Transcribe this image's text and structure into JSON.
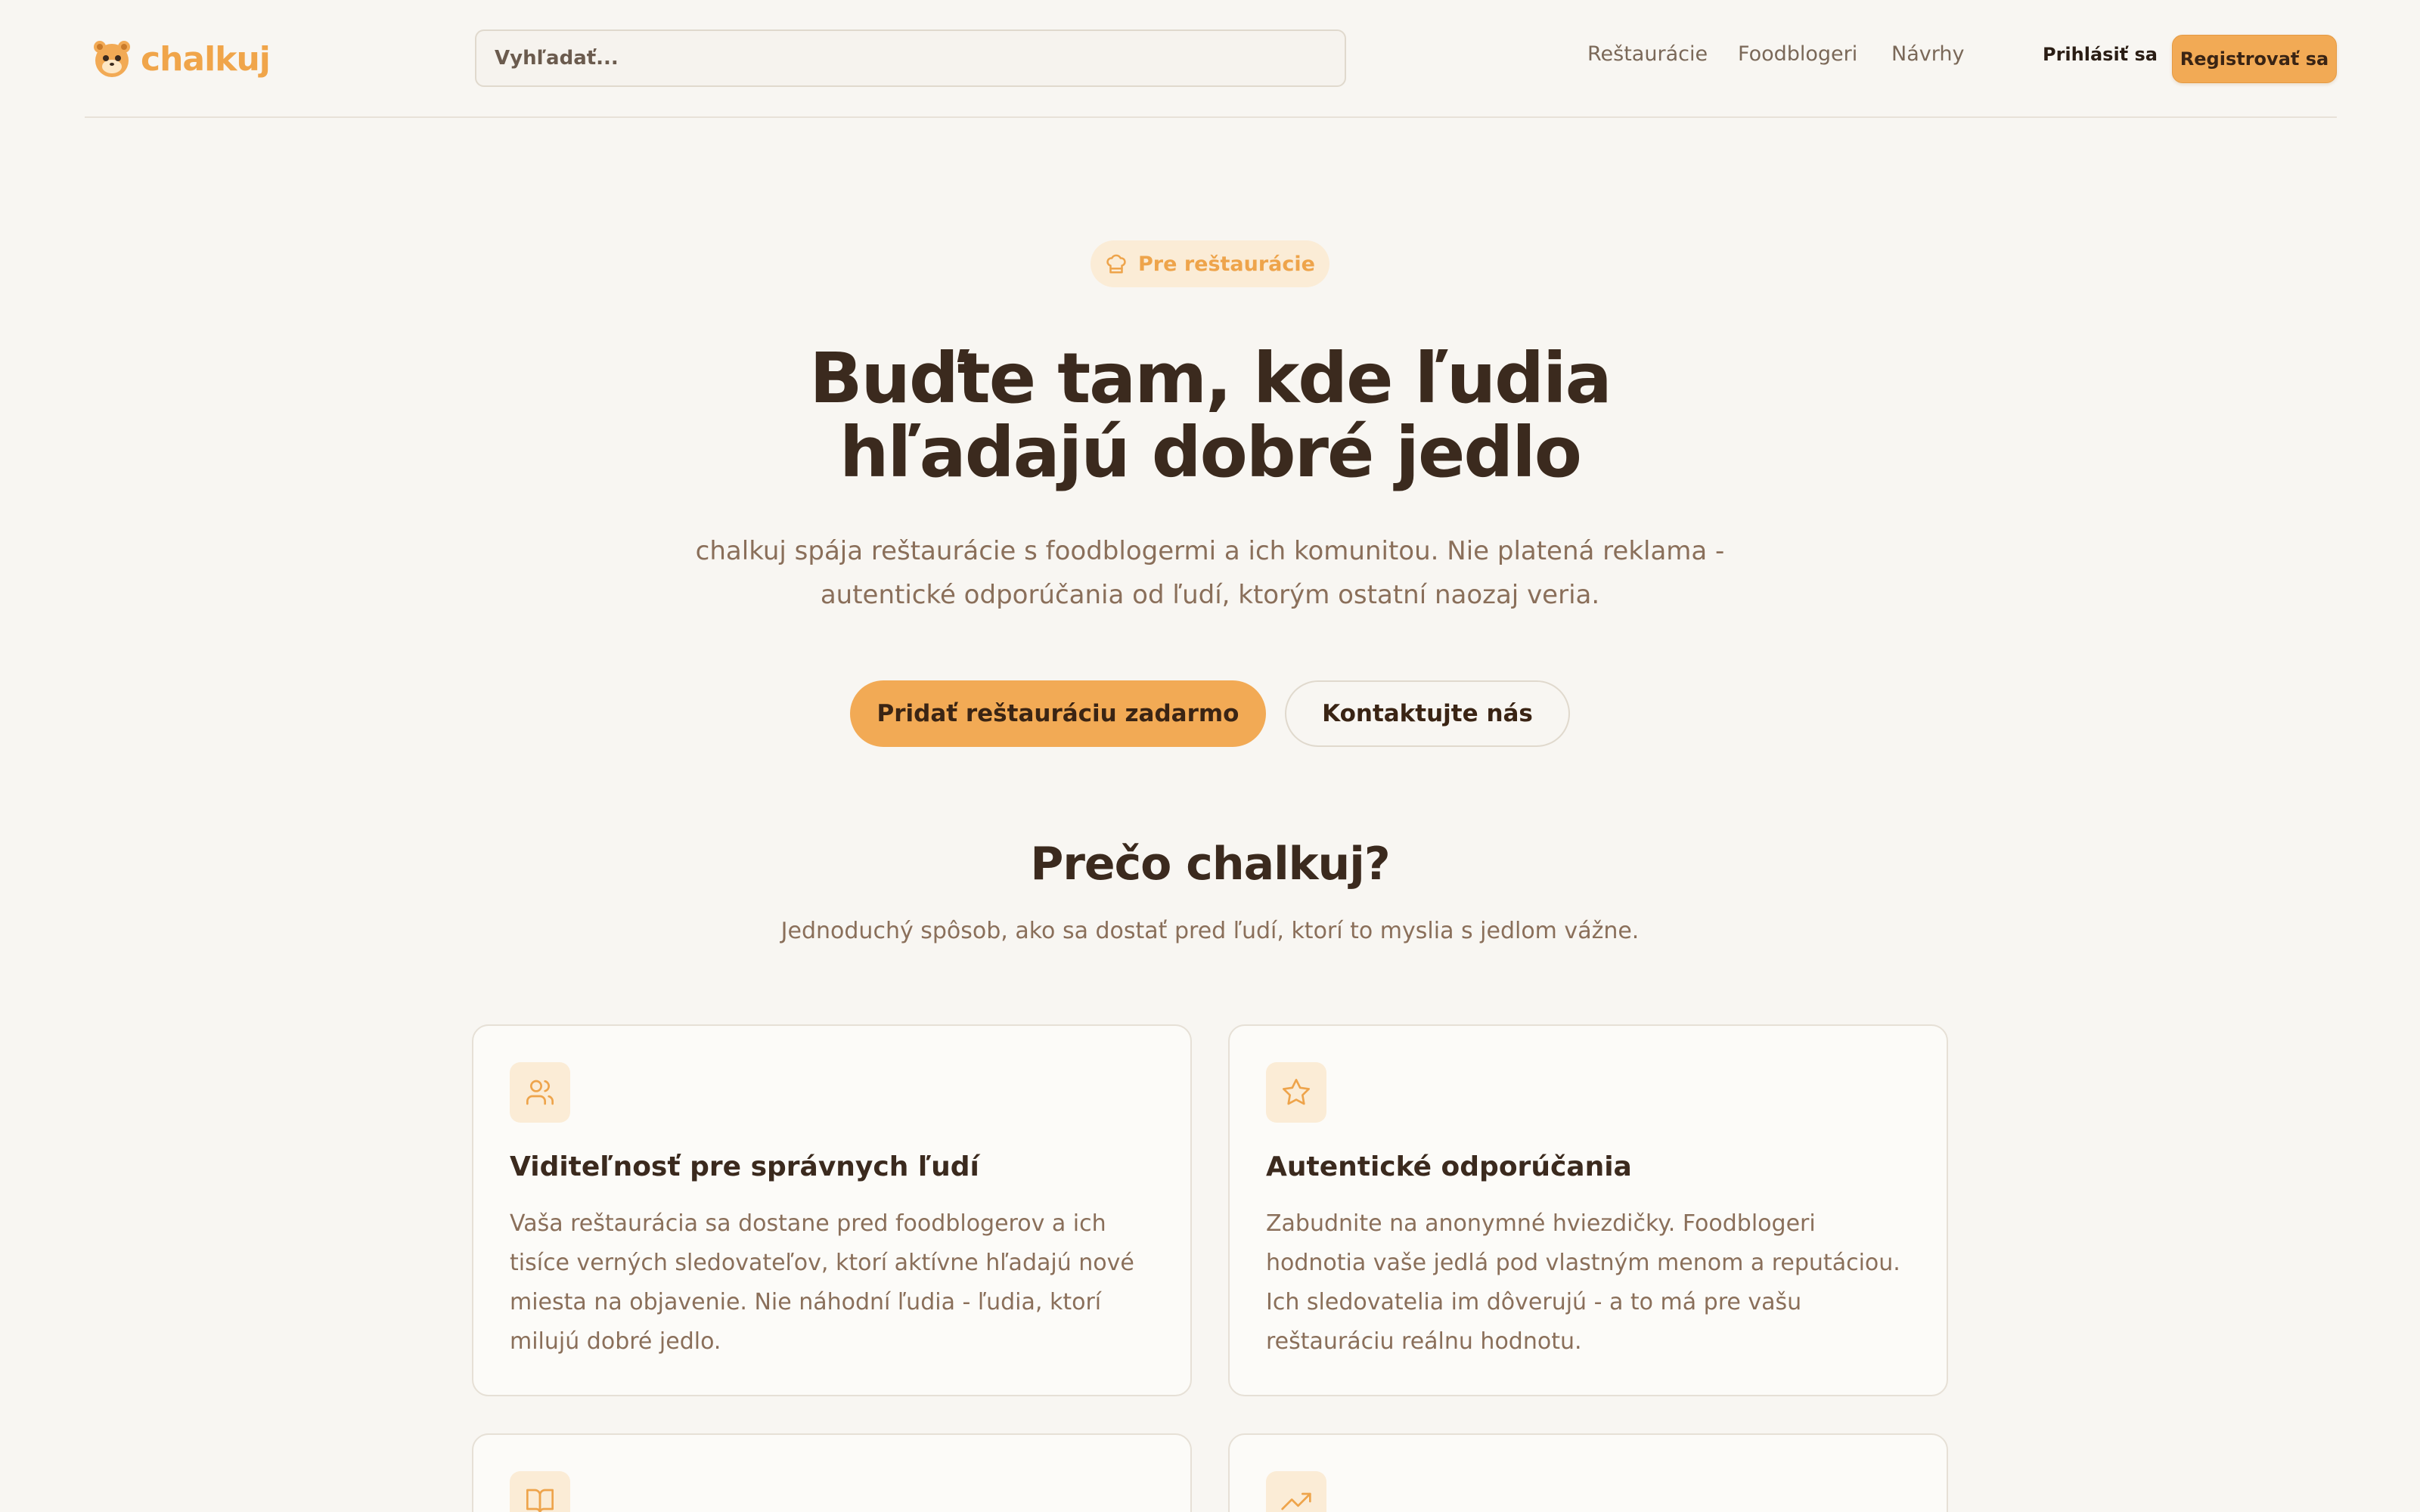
{
  "header": {
    "logo_text": "chalkuj",
    "search_placeholder": "Vyhľadať...",
    "nav": [
      "Reštaurácie",
      "Foodblogeri",
      "Návrhy"
    ],
    "login_label": "Prihlásiť sa",
    "register_label": "Registrovať sa"
  },
  "hero": {
    "badge": "Pre reštaurácie",
    "title_line1": "Buďte tam, kde ľudia",
    "title_line2": "hľadajú dobré jedlo",
    "subtitle_line1": "chalkuj spája reštaurácie s foodblogermi a ich komunitou. Nie platená reklama -",
    "subtitle_line2": "autentické odporúčania od ľudí, ktorým ostatní naozaj veria.",
    "primary_cta": "Pridať reštauráciu zadarmo",
    "secondary_cta": "Kontaktujte nás"
  },
  "why": {
    "title": "Prečo chalkuj?",
    "subtitle": "Jednoduchý spôsob, ako sa dostať pred ľudí, ktorí to myslia s jedlom vážne."
  },
  "features": [
    {
      "icon": "users-icon",
      "title": "Viditeľnosť pre správnych ľudí",
      "text": "Vaša reštaurácia sa dostane pred foodblogerov a ich tisíce verných sledovateľov, ktorí aktívne hľadajú nové miesta na objavenie. Nie náhodní ľudia - ľudia, ktorí milujú dobré jedlo."
    },
    {
      "icon": "star-icon",
      "title": "Autentické odporúčania",
      "text": "Zabudnite na anonymné hviezdičky. Foodblogeri hodnotia vaše jedlá pod vlastným menom a reputáciou. Ich sledovatelia im dôverujú - a to má pre vašu reštauráciu reálnu hodnotu."
    },
    {
      "icon": "book-icon"
    },
    {
      "icon": "trending-up-icon"
    }
  ],
  "colors": {
    "accent": "#f2aa55",
    "text_dark": "#3b2a1e",
    "text_muted": "#8a6f5a",
    "background": "#f8f6f2"
  }
}
